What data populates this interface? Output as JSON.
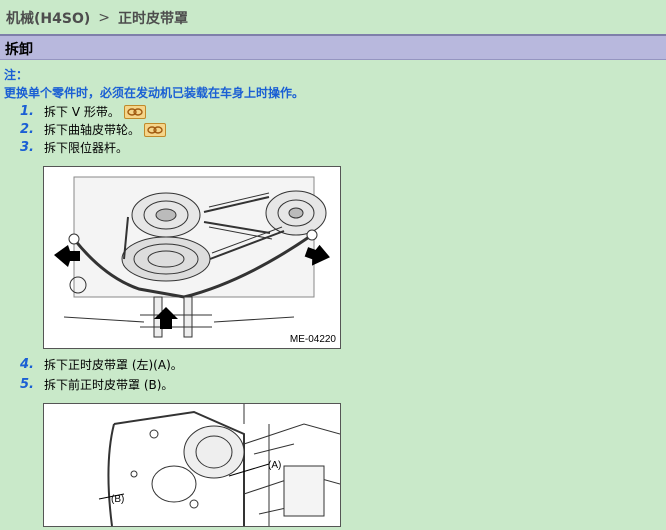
{
  "breadcrumb": {
    "parent": "机械(H4SO)",
    "separator": ">",
    "current": "正时皮带罩"
  },
  "section": {
    "title": "拆卸"
  },
  "note": {
    "label": "注：",
    "text": "更换单个零件时，必须在发动机已装载在车身上时操作。"
  },
  "steps": [
    {
      "num": "1.",
      "text": "拆下 V 形带。",
      "has_link": true
    },
    {
      "num": "2.",
      "text": "拆下曲轴皮带轮。",
      "has_link": true
    },
    {
      "num": "3.",
      "text": "拆下限位器杆。",
      "has_link": false
    },
    {
      "num": "4.",
      "text": "拆下正时皮带罩 (左)(A)。",
      "has_link": false
    },
    {
      "num": "5.",
      "text": "拆下前正时皮带罩 (B)。",
      "has_link": false
    }
  ],
  "figures": [
    {
      "code": "ME-04220"
    },
    {
      "label_a": "(A)",
      "label_b": "(B)"
    }
  ],
  "icons": {
    "link": "chain-link-icon"
  },
  "colors": {
    "background": "#c9e9c9",
    "section_bar": "#b8b8dd",
    "accent_blue": "#1a5fd4",
    "link_icon": "#f5d58a"
  }
}
